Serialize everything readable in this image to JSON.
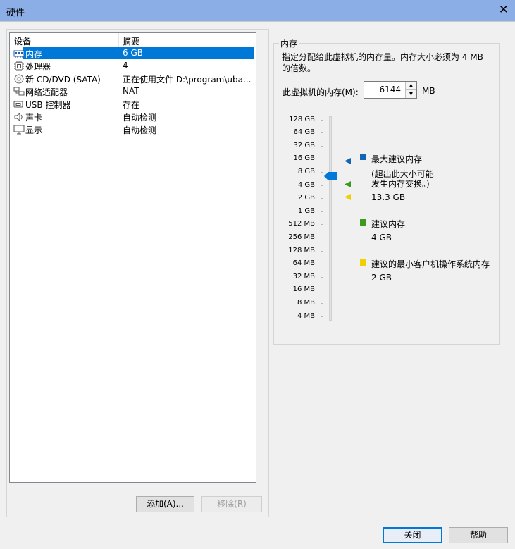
{
  "window": {
    "title": "硬件",
    "close_glyph": "✕"
  },
  "device_list": {
    "columns": [
      "设备",
      "摘要"
    ],
    "rows": [
      {
        "icon": "memory-icon",
        "name": "内存",
        "summary": "6 GB",
        "selected": true
      },
      {
        "icon": "processor-icon",
        "name": "处理器",
        "summary": "4"
      },
      {
        "icon": "cd-dvd-icon",
        "name": "新 CD/DVD (SATA)",
        "summary": "正在使用文件 D:\\program\\uba..."
      },
      {
        "icon": "network-adapter-icon",
        "name": "网络适配器",
        "summary": "NAT"
      },
      {
        "icon": "usb-icon",
        "name": "USB 控制器",
        "summary": "存在"
      },
      {
        "icon": "sound-card-icon",
        "name": "声卡",
        "summary": "自动检测"
      },
      {
        "icon": "display-icon",
        "name": "显示",
        "summary": "自动检测"
      }
    ]
  },
  "buttons": {
    "add": "添加(A)...",
    "remove": "移除(R)",
    "close": "关闭",
    "help": "帮助"
  },
  "memory_panel": {
    "group_title": "内存",
    "description": "指定分配给此虚拟机的内存量。内存大小必须为 4 MB 的倍数。",
    "field_label": "此虚拟机的内存(M):",
    "value": "6144",
    "unit": "MB",
    "scale_labels": [
      "128 GB",
      "64 GB",
      "32 GB",
      "16 GB",
      "8 GB",
      "4 GB",
      "2 GB",
      "1 GB",
      "512 MB",
      "256 MB",
      "128 MB",
      "64 MB",
      "32 MB",
      "16 MB",
      "8 MB",
      "4 MB"
    ],
    "colors": {
      "max": "#1464b4",
      "recommended": "#3c9a1e",
      "min": "#f0d000",
      "thumb": "#0078d7"
    },
    "legend": {
      "max_title": "最大建议内存",
      "max_note_1": "(超出此大小可能",
      "max_note_2": "发生内存交换。)",
      "max_value": "13.3 GB",
      "rec_title": "建议内存",
      "rec_value": "4 GB",
      "min_title": "建议的最小客户机操作系统内存",
      "min_value": "2 GB"
    }
  }
}
